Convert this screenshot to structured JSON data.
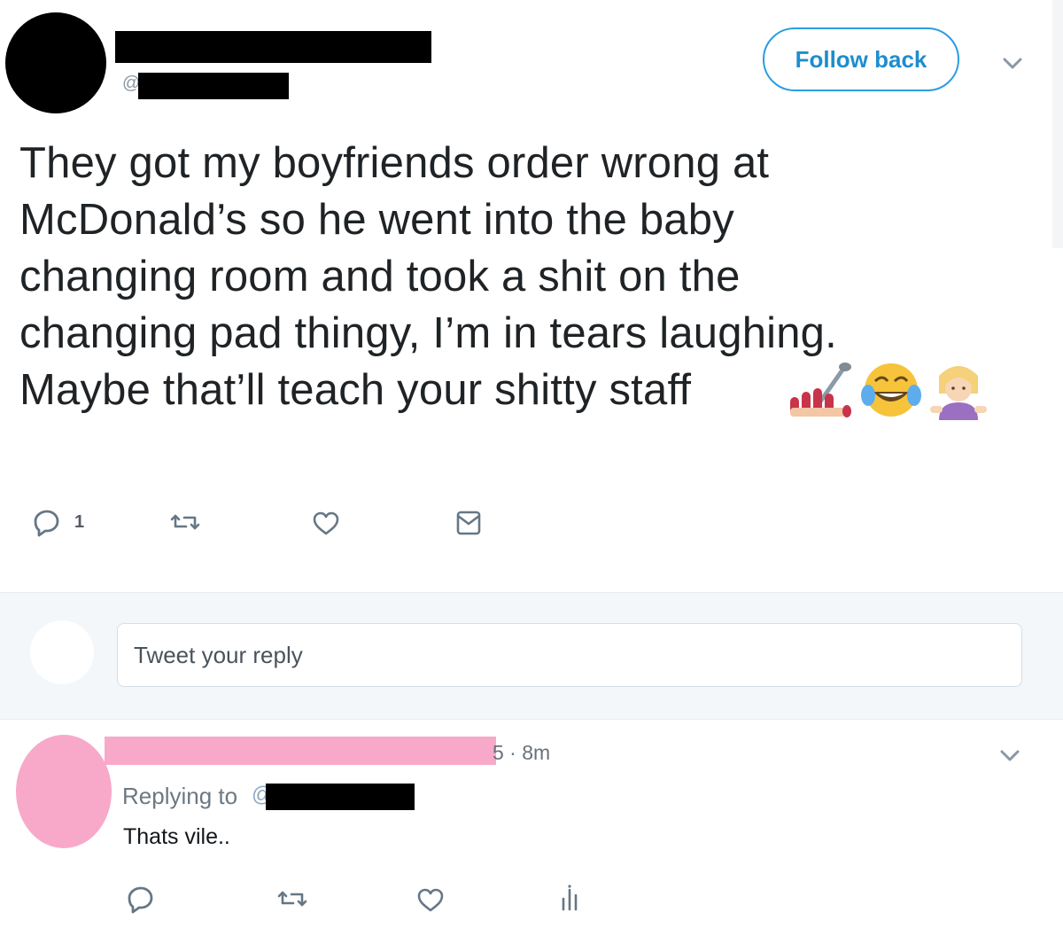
{
  "main_tweet": {
    "handle_prefix": "@",
    "follow_button_label": "Follow back",
    "text_lines": [
      "They got my boyfriends order wrong at",
      "McDonald’s so he went into the baby",
      "changing room and took a shit on the",
      "changing pad thingy, I’m in tears laughing.",
      "Maybe that’ll teach your shitty staff"
    ],
    "emojis": [
      "nail-polish",
      "face-with-tears-of-joy",
      "person-shrugging"
    ],
    "actions": {
      "reply_count": "1"
    }
  },
  "compose": {
    "placeholder": "Tweet your reply"
  },
  "reply_tweet": {
    "time": "5 · 8m",
    "replying_to_label": "Replying to",
    "handle_prefix": "@",
    "text": "Thats vile.."
  },
  "colors": {
    "accent": "#1d8dd0",
    "redaction_black": "#000000",
    "redaction_pink": "#f8a9c9",
    "icon_gray": "#657786",
    "compose_background": "#f4f7f9"
  }
}
